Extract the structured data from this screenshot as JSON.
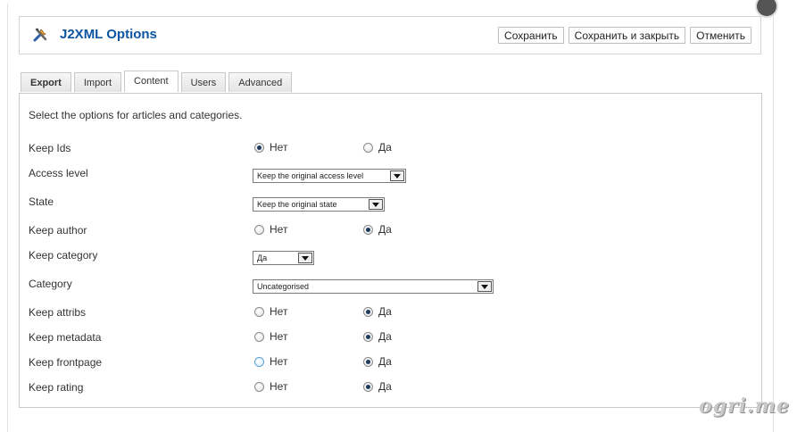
{
  "header": {
    "title": "J2XML Options",
    "icon": "tools-icon",
    "buttons": {
      "save": "Сохранить",
      "save_close": "Сохранить и закрыть",
      "cancel": "Отменить"
    }
  },
  "tabs": [
    {
      "label": "Export"
    },
    {
      "label": "Import"
    },
    {
      "label": "Content"
    },
    {
      "label": "Users"
    },
    {
      "label": "Advanced"
    }
  ],
  "active_tab": "Content",
  "content": {
    "intro": "Select the options for articles and categories.",
    "radio_no": "Нет",
    "radio_yes": "Да",
    "rows": {
      "keep_ids": {
        "label": "Keep Ids",
        "value": "Нет"
      },
      "access_level": {
        "label": "Access level",
        "value": "Keep the original access level"
      },
      "state": {
        "label": "State",
        "value": "Keep the original state"
      },
      "keep_author": {
        "label": "Keep author",
        "value": "Да"
      },
      "keep_category": {
        "label": "Keep category",
        "value": "Да"
      },
      "category": {
        "label": "Category",
        "value": "Uncategorised"
      },
      "keep_attribs": {
        "label": "Keep attribs",
        "value": "Да"
      },
      "keep_metadata": {
        "label": "Keep metadata",
        "value": "Да"
      },
      "keep_frontpage": {
        "label": "Keep frontpage",
        "value": "Да"
      },
      "keep_rating": {
        "label": "Keep rating",
        "value": "Да"
      }
    }
  },
  "watermark": "ogri.me",
  "colors": {
    "title": "#0b55a3",
    "radio_checked": "#1b3a5a"
  }
}
